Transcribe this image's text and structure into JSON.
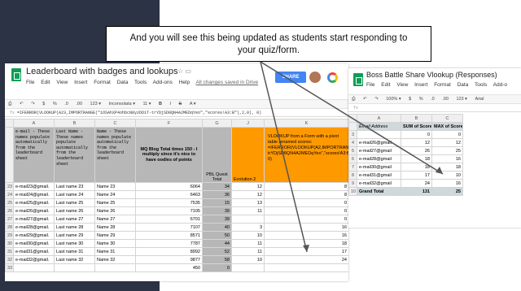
{
  "callout": {
    "line1": "And you will see this being updated as students start responding to",
    "line2": "your quiz/form."
  },
  "left_window": {
    "doc_title": "Leaderboard with badges and lookups",
    "title_icons": "☆ ▭",
    "menu": [
      "File",
      "Edit",
      "View",
      "Insert",
      "Format",
      "Data",
      "Tools",
      "Add-ons",
      "Help"
    ],
    "saved_status": "All changes saved in Drive",
    "share_label": "SHARE",
    "toolbar": [
      "⎙",
      "↶",
      "↷",
      "$",
      "%",
      ".0",
      ".00",
      "123 ▾",
      "Inconsolata ▾",
      "11 ▾",
      "B",
      "I",
      "S",
      "A ▾"
    ],
    "formula": "=IFERROR(VLOOKUP(A23,IMPORTRANGE(\"1OSAhXP4ohbcN8yzDOiT-trYDjSD8QN4A2MEDqYeo\",\"scores!A3:B\"),2,0), 0)",
    "formula_fx": "fx",
    "columns": [
      "A",
      "B",
      "C",
      "F",
      "G",
      "J",
      "K"
    ],
    "headers": {
      "email": "e-mail - These names populate automatically from the leaderboard sheet",
      "last": "Last Name - These names populate automatically from the leaderboard sheet",
      "name": "Name - These names populate automatically from the leaderboard sheet",
      "mq": "MQ Blog Total times 150 - I multiply since it's nice to have oodles of points",
      "pbl": "PBL Quest Total",
      "evo": "Evolution 2",
      "vlookup": "VLOOKUP from a Form with a pivot table renamed scores: =IFERROR(VLOOKUP(A2,IMPORTRANGE(\"1OSAhXP4ohbcN8yzDOiT-trYDjSD8QN4A2MEDqYeo\",\"scores!A3:B\"),2,0), 0)"
    },
    "rows": [
      {
        "n": "23",
        "email": "e-mail23@gmail.",
        "last": "Last name 23",
        "name": "Name 23",
        "mq": "6064",
        "pbl": "34",
        "evo": "12",
        "k": "8"
      },
      {
        "n": "24",
        "email": "e-mail24@gmail.",
        "last": "Last name 24",
        "name": "Name 24",
        "mq": "6463",
        "pbl": "36",
        "evo": "12",
        "k": "8"
      },
      {
        "n": "25",
        "email": "e-mail25@gmail.",
        "last": "Last name 25",
        "name": "Name 25",
        "mq": "7535",
        "pbl": "15",
        "evo": "13",
        "k": "0"
      },
      {
        "n": "26",
        "email": "e-mail26@gmail.",
        "last": "Last name 26",
        "name": "Name 26",
        "mq": "7105",
        "pbl": "39",
        "evo": "11",
        "k": "0"
      },
      {
        "n": "27",
        "email": "e-mail27@gmail.",
        "last": "Last name 27",
        "name": "Name 27",
        "mq": "6701",
        "pbl": "39",
        "evo": "",
        "k": "0"
      },
      {
        "n": "28",
        "email": "e-mail28@gmail.",
        "last": "Last name 28",
        "name": "Name 28",
        "mq": "7107",
        "pbl": "40",
        "evo": "3",
        "k": "16"
      },
      {
        "n": "29",
        "email": "e-mail29@gmail.",
        "last": "Last name 29",
        "name": "Name 29",
        "mq": "8571",
        "pbl": "50",
        "evo": "10",
        "k": "16"
      },
      {
        "n": "30",
        "email": "e-mail30@gmail.",
        "last": "Last name 30",
        "name": "Name 30",
        "mq": "7787",
        "pbl": "44",
        "evo": "11",
        "k": "18"
      },
      {
        "n": "31",
        "email": "e-mail31@gmail.",
        "last": "Last name 31",
        "name": "Name 31",
        "mq": "8992",
        "pbl": "52",
        "evo": "11",
        "k": "17"
      },
      {
        "n": "32",
        "email": "e-mail32@gmail.",
        "last": "Last name 32",
        "name": "Name 32",
        "mq": "9877",
        "pbl": "58",
        "evo": "10",
        "k": "24"
      },
      {
        "n": "33",
        "email": "",
        "last": "",
        "name": "",
        "mq": "450",
        "pbl": "0",
        "evo": "",
        "k": ""
      }
    ]
  },
  "right_window": {
    "doc_title": "Boss Battle Share Vlookup (Responses)",
    "menu": [
      "File",
      "Edit",
      "View",
      "Insert",
      "Format",
      "Data",
      "Tools",
      "Add-o"
    ],
    "toolbar": [
      "⎙",
      "↶",
      "↷",
      "100% ▾",
      "$",
      "%",
      ".0",
      ".00",
      "123 ▾",
      "Arial"
    ],
    "fx": "fx",
    "columns": [
      "A",
      "B",
      "C"
    ],
    "headers": {
      "email": "Email Address",
      "sum": "SUM of Score",
      "max": "MAX of Score"
    },
    "rows": [
      {
        "n": "3",
        "email": "",
        "sum": "0",
        "max": "0"
      },
      {
        "n": "4",
        "email": "e-mail26@gmail",
        "sum": "12",
        "max": "12"
      },
      {
        "n": "5",
        "email": "e-mail27@gmail",
        "sum": "26",
        "max": "25"
      },
      {
        "n": "6",
        "email": "e-mail28@gmail",
        "sum": "18",
        "max": "16"
      },
      {
        "n": "7",
        "email": "e-mail30@gmail",
        "sum": "18",
        "max": "18"
      },
      {
        "n": "8",
        "email": "e-mail31@gmail",
        "sum": "17",
        "max": "10"
      },
      {
        "n": "9",
        "email": "e-mail32@gmail",
        "sum": "24",
        "max": "16"
      }
    ],
    "total": {
      "n": "10",
      "label": "Grand Total",
      "sum": "131",
      "max": "25"
    }
  },
  "colors": {
    "dark_band": "#2b3344",
    "gray_header": "#b7b7b7",
    "orange_header": "#ff9900",
    "share_blue": "#4285f4",
    "sheets_green": "#0f9d58"
  }
}
